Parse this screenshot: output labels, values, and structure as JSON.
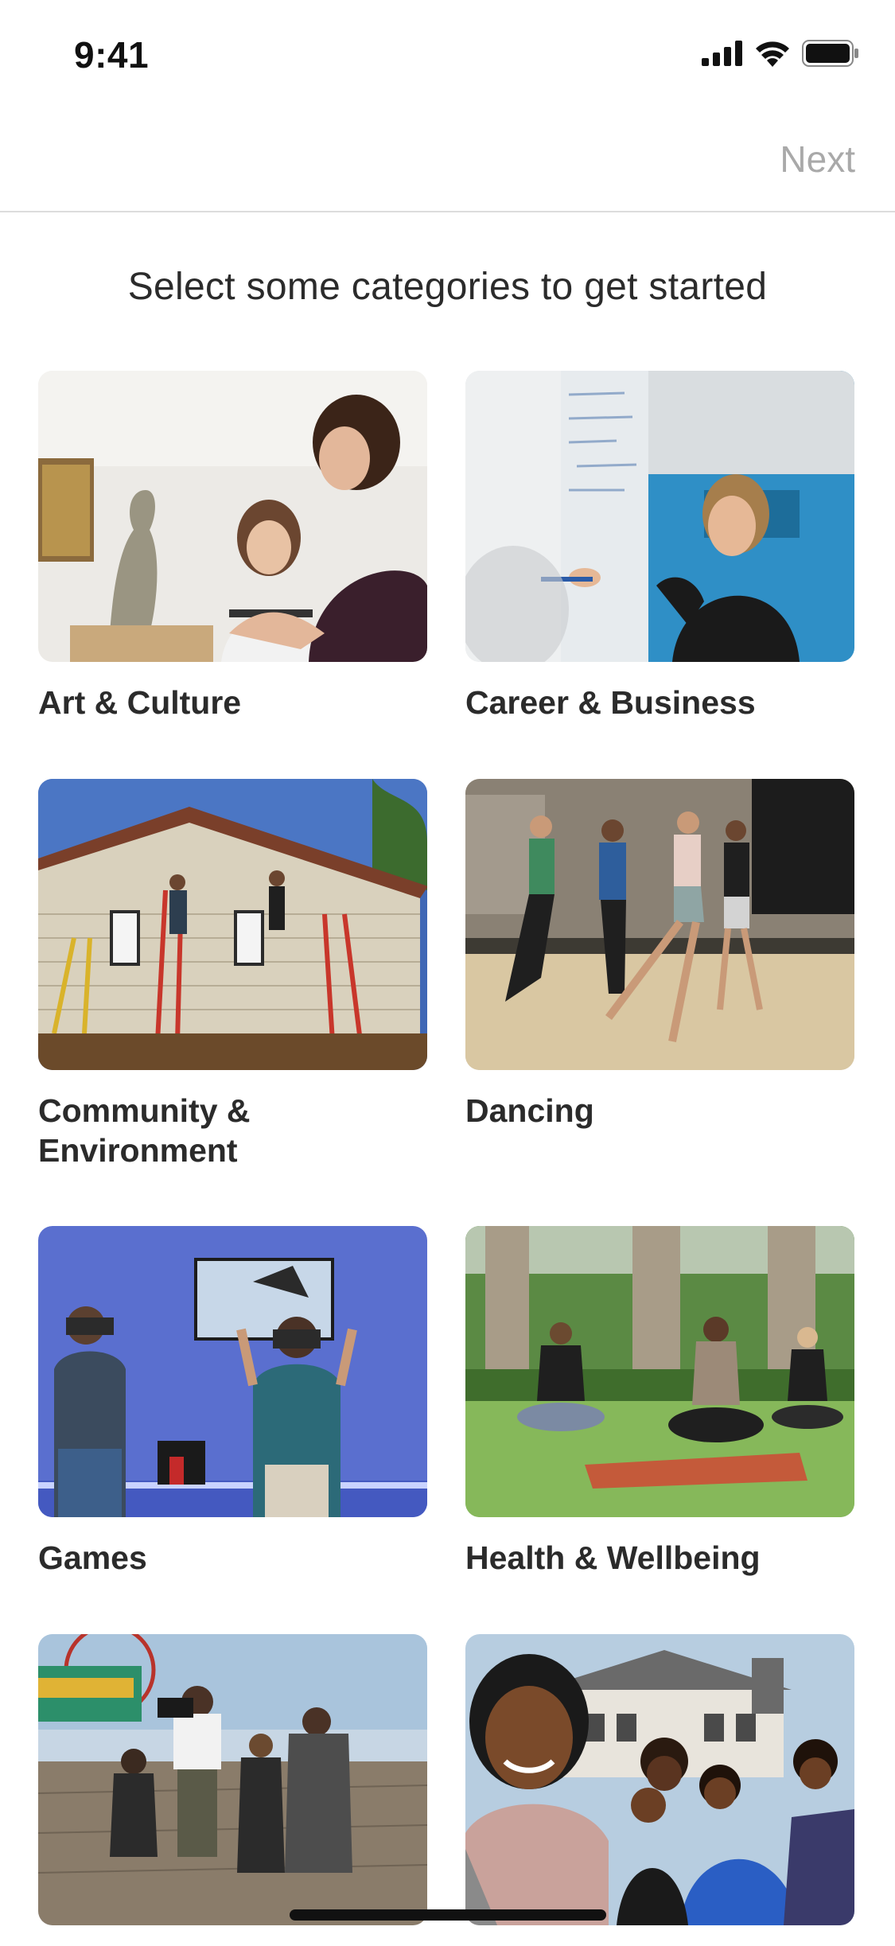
{
  "status": {
    "time": "9:41"
  },
  "nav": {
    "next_label": "Next"
  },
  "header": {
    "title": "Select some categories to get started"
  },
  "categories": [
    {
      "label": "Art & Culture"
    },
    {
      "label": "Career & Business"
    },
    {
      "label": "Community & Environment"
    },
    {
      "label": "Dancing"
    },
    {
      "label": "Games"
    },
    {
      "label": "Health & Wellbeing"
    },
    {
      "label": ""
    },
    {
      "label": ""
    }
  ],
  "icons": [
    "signal-icon",
    "wifi-icon",
    "battery-icon"
  ]
}
